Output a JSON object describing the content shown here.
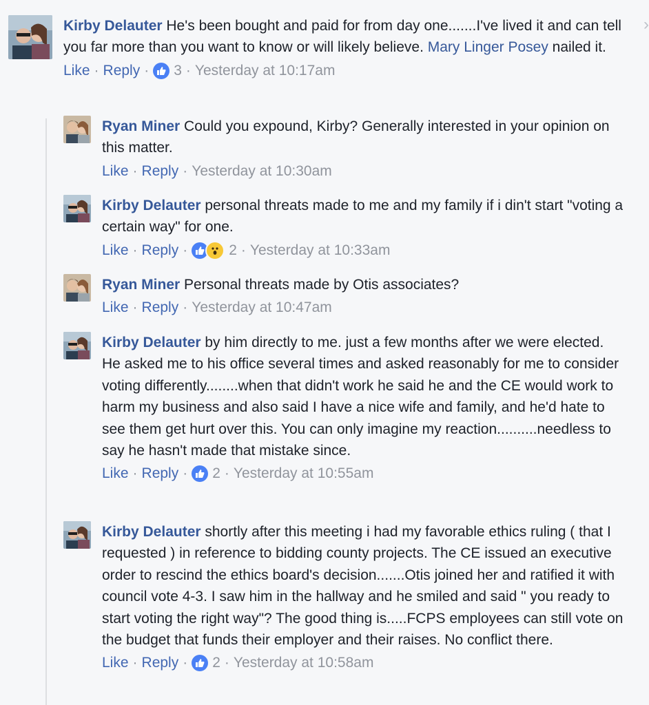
{
  "comments": [
    {
      "author": "Kirby Delauter",
      "text_before_mention": " He's been bought and paid for from day one.......I've lived it and can tell you far more than you want to know or will likely believe. ",
      "mention": "Mary Linger Posey",
      "text_after_mention": " nailed it.",
      "like_label": "Like",
      "reply_label": "Reply",
      "reaction_count": "3",
      "timestamp": "Yesterday at 10:17am"
    }
  ],
  "replies": [
    {
      "author": "Ryan Miner",
      "text": " Could you expound, Kirby? Generally interested in your opinion on this matter.",
      "like_label": "Like",
      "reply_label": "Reply",
      "timestamp": "Yesterday at 10:30am"
    },
    {
      "author": "Kirby Delauter",
      "text": " personal threats made to me and my family if i din't start \"voting a certain way\" for one.",
      "like_label": "Like",
      "reply_label": "Reply",
      "reaction_count": "2",
      "timestamp": "Yesterday at 10:33am"
    },
    {
      "author": "Ryan Miner",
      "text": " Personal threats made by Otis associates?",
      "like_label": "Like",
      "reply_label": "Reply",
      "timestamp": "Yesterday at 10:47am"
    },
    {
      "author": "Kirby Delauter",
      "text": " by him directly to me. just a few months after we were elected. He asked me to his office several times and asked reasonably for me to consider voting differently........when that didn't work he said he and the CE would work to harm my business and also said I have a nice wife and family, and he'd hate to see them get hurt over this. You can only imagine my reaction..........needless to say he hasn't made that mistake since.",
      "like_label": "Like",
      "reply_label": "Reply",
      "reaction_count": "2",
      "timestamp": "Yesterday at 10:55am"
    },
    {
      "author": "Kirby Delauter",
      "text": " shortly after this meeting i had my favorable ethics ruling ( that I requested ) in reference to bidding county projects. The CE issued an executive order to rescind the ethics board's decision.......Otis joined her and ratified it with council vote 4-3. I saw him in the hallway and he smiled and said \" you ready to start voting the right way\"? The good thing is.....FCPS employees can still vote on the budget that funds their employer and their raises. No conflict there.",
      "like_label": "Like",
      "reply_label": "Reply",
      "reaction_count": "2",
      "timestamp": "Yesterday at 10:58am"
    }
  ],
  "separator": "·",
  "colors": {
    "link": "#365899",
    "action": "#4267b2",
    "meta": "#90949c",
    "like": "#4a80f5",
    "wow": "#f7c836"
  },
  "icons": [
    "like-reaction-icon",
    "wow-reaction-icon",
    "chevron-right-icon"
  ]
}
